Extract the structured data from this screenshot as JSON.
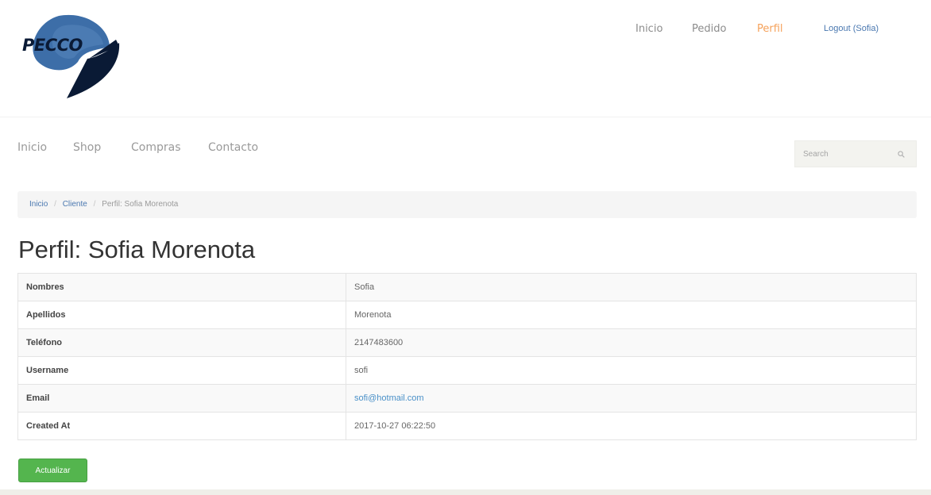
{
  "header": {
    "logo_text": "PECCO",
    "top_nav": [
      {
        "label": "Inicio"
      },
      {
        "label": "Pedido"
      },
      {
        "label": "Perfil"
      }
    ],
    "logout_label": "Logout (Sofia)"
  },
  "main_nav": [
    {
      "label": "Inicio"
    },
    {
      "label": "Shop"
    },
    {
      "label": "Compras"
    },
    {
      "label": "Contacto"
    }
  ],
  "search": {
    "placeholder": "Search"
  },
  "breadcrumb": {
    "home": "Inicio",
    "separator": "/",
    "cliente": "Cliente",
    "current": "Perfil: Sofia Morenota"
  },
  "page_title": "Perfil: Sofia Morenota",
  "details": [
    {
      "label": "Nombres",
      "value": "Sofia"
    },
    {
      "label": "Apellidos",
      "value": "Morenota"
    },
    {
      "label": "Teléfono",
      "value": "2147483600"
    },
    {
      "label": "Username",
      "value": "sofi"
    },
    {
      "label": "Email",
      "value": "sofi@hotmail.com"
    },
    {
      "label": "Created At",
      "value": "2017-10-27 06:22:50"
    }
  ],
  "actions": {
    "update_label": "Actualizar"
  },
  "colors": {
    "active_nav": "#f5a15a",
    "link": "#4a78b0",
    "button": "#54b54e",
    "logo_blue": "#3d6ea8",
    "logo_dark": "#0a1a35"
  }
}
